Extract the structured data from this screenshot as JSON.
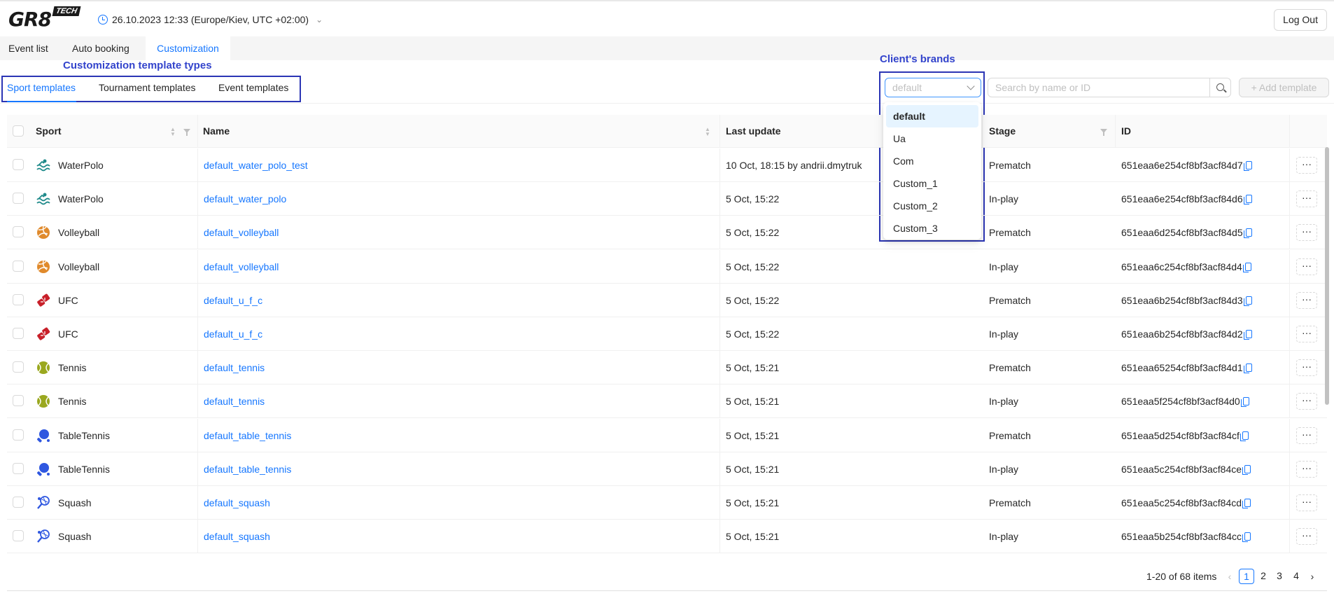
{
  "header": {
    "logo_text": "GR8",
    "logo_badge": "TECH",
    "datetime": "26.10.2023 12:33 (Europe/Kiev, UTC +02:00)",
    "logout_label": "Log Out"
  },
  "main_tabs": [
    {
      "label": "Event list"
    },
    {
      "label": "Auto booking"
    },
    {
      "label": "Customization",
      "active": true
    }
  ],
  "annotations": {
    "template_types": "Customization template types",
    "brands": "Client's brands"
  },
  "sub_tabs": [
    {
      "label": "Sport templates",
      "active": true
    },
    {
      "label": "Tournament templates"
    },
    {
      "label": "Event templates"
    }
  ],
  "brand_select": {
    "value": "default",
    "options": [
      "default",
      "Ua",
      "Com",
      "Custom_1",
      "Custom_2",
      "Custom_3"
    ],
    "selected": "default"
  },
  "search": {
    "placeholder": "Search by name or ID"
  },
  "add_template_label": "+ Add template",
  "table": {
    "columns": {
      "sport": "Sport",
      "name": "Name",
      "last_update": "Last update",
      "stage": "Stage",
      "id": "ID"
    },
    "rows": [
      {
        "sport": "WaterPolo",
        "icon": "water-polo-icon",
        "name": "default_water_polo_test",
        "last_update": "10 Oct, 18:15 by andrii.dmytruk",
        "stage": "Prematch",
        "id": "651eaa6e254cf8bf3acf84d7"
      },
      {
        "sport": "WaterPolo",
        "icon": "water-polo-icon",
        "name": "default_water_polo",
        "last_update": "5 Oct, 15:22",
        "stage": "In-play",
        "id": "651eaa6e254cf8bf3acf84d6"
      },
      {
        "sport": "Volleyball",
        "icon": "volleyball-icon",
        "name": "default_volleyball",
        "last_update": "5 Oct, 15:22",
        "stage": "Prematch",
        "id": "651eaa6d254cf8bf3acf84d5"
      },
      {
        "sport": "Volleyball",
        "icon": "volleyball-icon",
        "name": "default_volleyball",
        "last_update": "5 Oct, 15:22",
        "stage": "In-play",
        "id": "651eaa6c254cf8bf3acf84d4"
      },
      {
        "sport": "UFC",
        "icon": "ufc-icon",
        "name": "default_u_f_c",
        "last_update": "5 Oct, 15:22",
        "stage": "Prematch",
        "id": "651eaa6b254cf8bf3acf84d3"
      },
      {
        "sport": "UFC",
        "icon": "ufc-icon",
        "name": "default_u_f_c",
        "last_update": "5 Oct, 15:22",
        "stage": "In-play",
        "id": "651eaa6b254cf8bf3acf84d2"
      },
      {
        "sport": "Tennis",
        "icon": "tennis-icon",
        "name": "default_tennis",
        "last_update": "5 Oct, 15:21",
        "stage": "Prematch",
        "id": "651eaa65254cf8bf3acf84d1"
      },
      {
        "sport": "Tennis",
        "icon": "tennis-icon",
        "name": "default_tennis",
        "last_update": "5 Oct, 15:21",
        "stage": "In-play",
        "id": "651eaa5f254cf8bf3acf84d0"
      },
      {
        "sport": "TableTennis",
        "icon": "table-tennis-icon",
        "name": "default_table_tennis",
        "last_update": "5 Oct, 15:21",
        "stage": "Prematch",
        "id": "651eaa5d254cf8bf3acf84cf"
      },
      {
        "sport": "TableTennis",
        "icon": "table-tennis-icon",
        "name": "default_table_tennis",
        "last_update": "5 Oct, 15:21",
        "stage": "In-play",
        "id": "651eaa5c254cf8bf3acf84ce"
      },
      {
        "sport": "Squash",
        "icon": "squash-icon",
        "name": "default_squash",
        "last_update": "5 Oct, 15:21",
        "stage": "Prematch",
        "id": "651eaa5c254cf8bf3acf84cd"
      },
      {
        "sport": "Squash",
        "icon": "squash-icon",
        "name": "default_squash",
        "last_update": "5 Oct, 15:21",
        "stage": "In-play",
        "id": "651eaa5b254cf8bf3acf84cc"
      }
    ],
    "row_actions_label": "···"
  },
  "pagination": {
    "summary": "1-20 of 68 items",
    "pages": [
      "1",
      "2",
      "3",
      "4"
    ],
    "current": "1"
  },
  "colors": {
    "accent": "#1677ff",
    "annotation": "#3344cc",
    "water_polo": "#1f8a8a",
    "volleyball": "#e08a2c",
    "ufc": "#c8202a",
    "tennis": "#9aa81f",
    "table_tennis": "#2f57e0",
    "squash": "#2f57e0"
  }
}
